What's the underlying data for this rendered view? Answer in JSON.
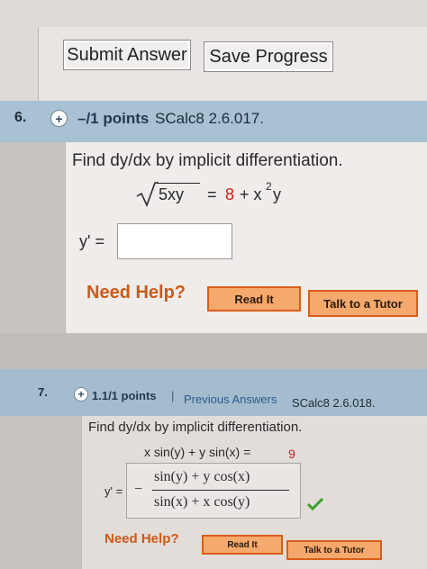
{
  "buttons": {
    "submit": "Submit Answer",
    "save": "Save Progress"
  },
  "q6": {
    "number": "6.",
    "points": "–/1 points",
    "code": "SCalc8 2.6.017.",
    "prompt": "Find dy/dx by implicit differentiation.",
    "eq_lhs": "5xy",
    "eq_eq": "=",
    "eq_const": "8",
    "eq_rest": "+ x",
    "eq_exp": "2",
    "eq_tail": "y",
    "answer_label": "y' =",
    "answer_value": "",
    "need_help": "Need Help?",
    "read_it": "Read It",
    "tutor": "Talk to a Tutor"
  },
  "q7": {
    "number": "7.",
    "points": "1.1/1 points",
    "separator": "|",
    "prev": "Previous Answers",
    "code": "SCalc8 2.6.018.",
    "prompt": "Find dy/dx by implicit differentiation.",
    "eq_left": "x sin(y) + y sin(x) =",
    "eq_const": "9",
    "answer_label": "y' =",
    "minus": "−",
    "numerator": "sin(y) + y cos(x)",
    "denominator": "sin(x) + x cos(y)",
    "need_help": "Need Help?",
    "read_it": "Read It",
    "tutor": "Talk to a Tutor"
  },
  "colors": {
    "band": "#a8c1d3",
    "red": "#cc1f1f",
    "help_orange": "#cc5a18",
    "check_green": "#3aa12c"
  }
}
